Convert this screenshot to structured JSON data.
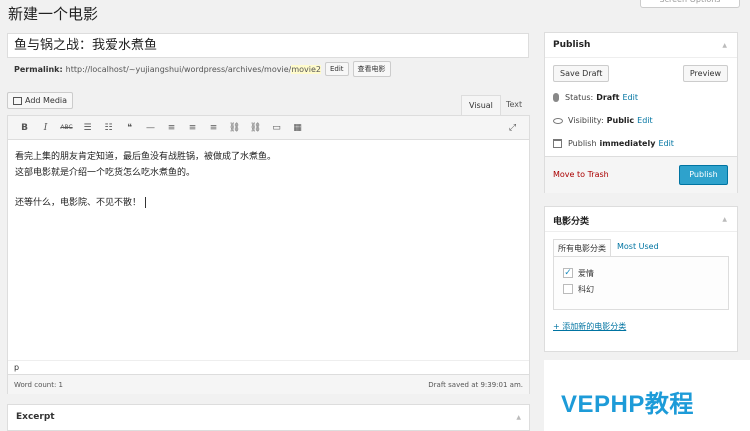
{
  "header": {
    "page_title": "新建一个电影",
    "screen_options": "Screen Options"
  },
  "post": {
    "title": "鱼与锅之战：我爱水煮鱼",
    "permalink_label": "Permalink:",
    "permalink_base": "http://localhost/~yujiangshui/wordpress/archives/movie/",
    "permalink_slug": "movie2",
    "edit_button": "Edit",
    "view_button": "查看电影"
  },
  "editor": {
    "add_media": "Add Media",
    "tab_visual": "Visual",
    "tab_text": "Text",
    "toolbar": [
      {
        "name": "bold-button",
        "glyph": "B"
      },
      {
        "name": "italic-button",
        "glyph": "I"
      },
      {
        "name": "strikethrough-button",
        "glyph": "ABC"
      },
      {
        "name": "bullet-list-button",
        "glyph": "☰"
      },
      {
        "name": "numbered-list-button",
        "glyph": "☷"
      },
      {
        "name": "blockquote-button",
        "glyph": "❝"
      },
      {
        "name": "horizontal-rule-button",
        "glyph": "—"
      },
      {
        "name": "align-left-button",
        "glyph": "≡"
      },
      {
        "name": "align-center-button",
        "glyph": "≡"
      },
      {
        "name": "align-right-button",
        "glyph": "≡"
      },
      {
        "name": "insert-link-button",
        "glyph": "⛓"
      },
      {
        "name": "remove-link-button",
        "glyph": "⛓"
      },
      {
        "name": "read-more-button",
        "glyph": "▭"
      },
      {
        "name": "toolbar-toggle-button",
        "glyph": "▦"
      }
    ],
    "paragraphs": [
      "看完上集的朋友肯定知道，最后鱼没有战胜锅，被做成了水煮鱼。",
      "这部电影就是介绍一个吃货怎么吃水煮鱼的。",
      "还等什么，电影院、不见不散！"
    ],
    "path": "p",
    "word_count": "Word count: 1",
    "draft_saved": "Draft saved at 9:39:01 am."
  },
  "excerpt": {
    "title": "Excerpt"
  },
  "publish_box": {
    "title": "Publish",
    "save_draft": "Save Draft",
    "preview": "Preview",
    "status_label": "Status:",
    "status_value": "Draft",
    "visibility_label": "Visibility:",
    "visibility_value": "Public",
    "publish_label": "Publish",
    "publish_value": "immediately",
    "edit_link": "Edit",
    "move_to_trash": "Move to Trash",
    "publish_button": "Publish"
  },
  "categories_box": {
    "title": "电影分类",
    "tab_all": "所有电影分类",
    "tab_most_used": "Most Used",
    "items": [
      {
        "label": "爱情",
        "checked": true
      },
      {
        "label": "科幻",
        "checked": false
      }
    ],
    "add_new": "+ 添加新的电影分类"
  },
  "watermark": "VEPHP教程"
}
